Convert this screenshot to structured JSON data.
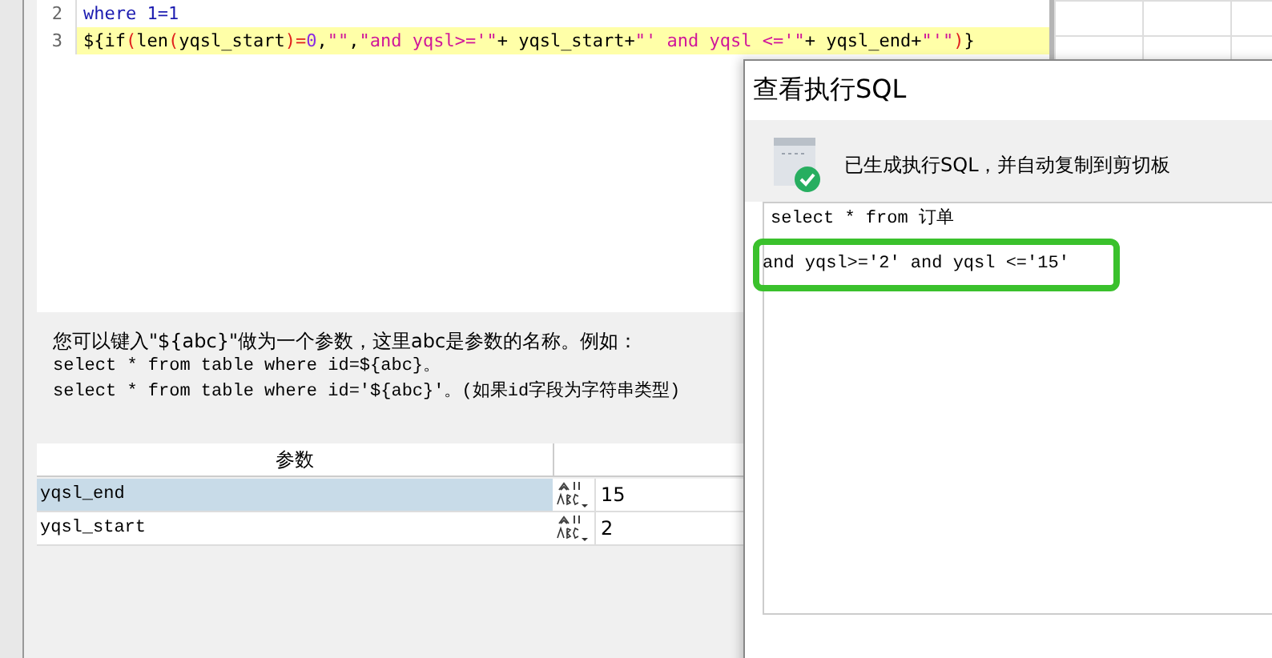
{
  "editor": {
    "lines": [
      {
        "number": "2",
        "tokens": [
          {
            "kind": "keyword",
            "text": "where 1=1"
          }
        ],
        "current": false
      },
      {
        "number": "3",
        "tokens": [
          {
            "kind": "plain",
            "text": "${"
          },
          {
            "kind": "func",
            "text": "if"
          },
          {
            "kind": "paren",
            "text": "("
          },
          {
            "kind": "func",
            "text": "len"
          },
          {
            "kind": "paren",
            "text": "("
          },
          {
            "kind": "plain",
            "text": "yqsl_start"
          },
          {
            "kind": "paren",
            "text": ")"
          },
          {
            "kind": "op",
            "text": "="
          },
          {
            "kind": "number",
            "text": "0"
          },
          {
            "kind": "plain",
            "text": ","
          },
          {
            "kind": "string",
            "text": "\"\""
          },
          {
            "kind": "plain",
            "text": ","
          },
          {
            "kind": "string",
            "text": "\"and yqsl>='\""
          },
          {
            "kind": "plain",
            "text": "+ yqsl_start+"
          },
          {
            "kind": "string",
            "text": "\"' and yqsl <='\""
          },
          {
            "kind": "plain",
            "text": "+ yqsl_end+"
          },
          {
            "kind": "string",
            "text": "\"'\""
          },
          {
            "kind": "paren",
            "text": ")"
          },
          {
            "kind": "plain",
            "text": "}"
          }
        ],
        "current": true
      }
    ]
  },
  "hint": {
    "lines": [
      "您可以键入\"${abc}\"做为一个参数，这里abc是参数的名称。例如：",
      "select * from table where id=${abc}。",
      "select * from table where id='${abc}'。(如果id字段为字符串类型)"
    ]
  },
  "params": {
    "columns": [
      "参数"
    ],
    "rows": [
      {
        "name": "yqsl_end",
        "value": "15",
        "selected": true
      },
      {
        "name": "yqsl_start",
        "value": "2",
        "selected": false
      }
    ]
  },
  "dialog": {
    "title": "查看执行SQL",
    "message": "已生成执行SQL，并自动复制到剪切板",
    "sql_lines": [
      {
        "text": "select * from 订单",
        "highlighted": false
      },
      {
        "text": "and yqsl>='2' and yqsl <='15'",
        "highlighted": true
      }
    ]
  }
}
